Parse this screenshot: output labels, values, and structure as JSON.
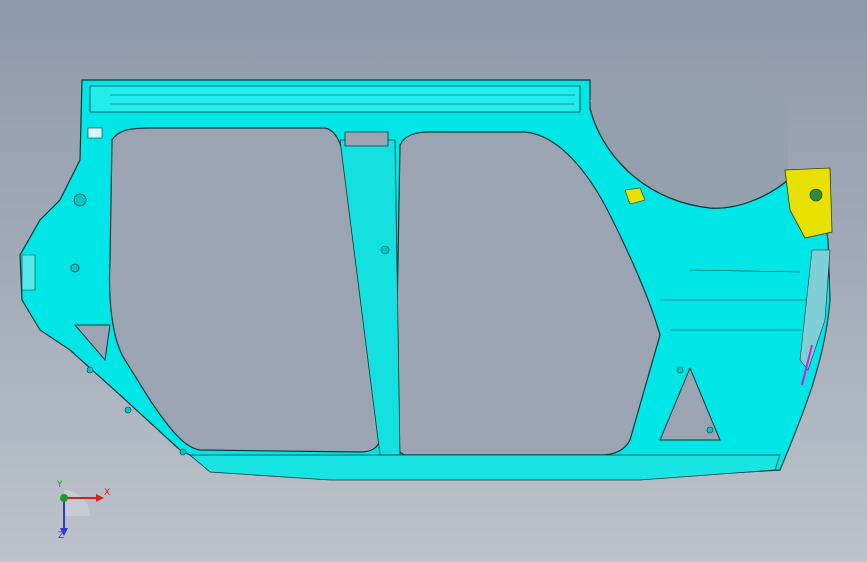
{
  "viewport": {
    "background_top": "#8e99a9",
    "background_bottom": "#bcc3cc"
  },
  "model": {
    "part": "side-body-panel",
    "body_color": "#00e5e5",
    "edge_color": "#0a3a3a",
    "bracket_color": "#e8e000",
    "accent_color": "#d020d0"
  },
  "triad": {
    "x_label": "X",
    "y_label": "Y",
    "z_label": "Z",
    "x_color": "#d92020",
    "y_color": "#1c9a2a",
    "z_color": "#2a3bd6"
  }
}
